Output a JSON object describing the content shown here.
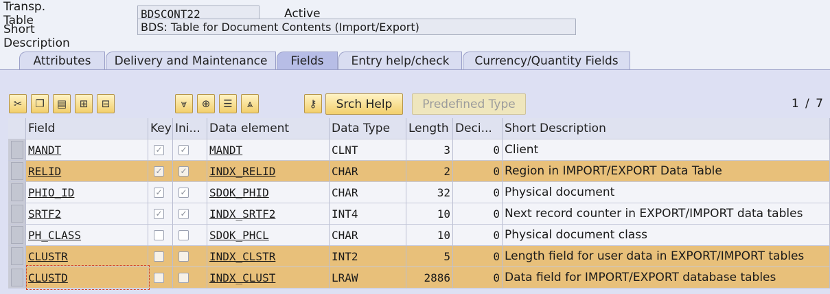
{
  "header": {
    "table_label": "Transp. Table",
    "table_value": "BDSCONT22",
    "status": "Active",
    "desc_label": "Short Description",
    "desc_value": "BDS: Table for Document Contents (Import/Export)"
  },
  "tabs": [
    {
      "label": "Attributes"
    },
    {
      "label": "Delivery and Maintenance"
    },
    {
      "label": "Fields"
    },
    {
      "label": "Entry help/check"
    },
    {
      "label": "Currency/Quantity Fields"
    }
  ],
  "active_tab": "Fields",
  "toolbar": {
    "srch_help": "Srch Help",
    "predefined_type": "Predefined Type",
    "pager": "1 / 7",
    "icons": [
      "cut-icon",
      "copy-icon",
      "paste-icon",
      "insert-row-icon",
      "delete-row-icon",
      "sort-icon",
      "insert-icon",
      "sort-desc-icon",
      "sort-asc-icon",
      "key-icon"
    ]
  },
  "columns": [
    "Field",
    "Key",
    "Ini...",
    "Data element",
    "Data Type",
    "Length",
    "Deci...",
    "Short Description"
  ],
  "rows": [
    {
      "field": "MANDT",
      "key": true,
      "ini": true,
      "element": "MANDT",
      "type": "CLNT",
      "length": "3",
      "deci": "0",
      "desc": "Client",
      "highlight": false
    },
    {
      "field": "RELID",
      "key": true,
      "ini": true,
      "element": "INDX_RELID",
      "type": "CHAR",
      "length": "2",
      "deci": "0",
      "desc": "Region in IMPORT/EXPORT Data Table",
      "highlight": true
    },
    {
      "field": "PHIO_ID",
      "key": true,
      "ini": true,
      "element": "SDOK_PHID",
      "type": "CHAR",
      "length": "32",
      "deci": "0",
      "desc": "Physical document",
      "highlight": false
    },
    {
      "field": "SRTF2",
      "key": true,
      "ini": true,
      "element": "INDX_SRTF2",
      "type": "INT4",
      "length": "10",
      "deci": "0",
      "desc": "Next record counter in EXPORT/IMPORT data tables",
      "highlight": false
    },
    {
      "field": "PH_CLASS",
      "key": false,
      "ini": false,
      "element": "SDOK_PHCL",
      "type": "CHAR",
      "length": "10",
      "deci": "0",
      "desc": "Physical document class",
      "highlight": false
    },
    {
      "field": "CLUSTR",
      "key": false,
      "ini": false,
      "element": "INDX_CLSTR",
      "type": "INT2",
      "length": "5",
      "deci": "0",
      "desc": "Length field for user data in EXPORT/IMPORT tables",
      "highlight": true
    },
    {
      "field": "CLUSTD",
      "key": false,
      "ini": false,
      "element": "INDX_CLUST",
      "type": "LRAW",
      "length": "2886",
      "deci": "0",
      "desc": "Data field for IMPORT/EXPORT database tables",
      "highlight": true
    }
  ],
  "colors": {
    "highlight_row": "#e8c07a",
    "panel": "#dde0f3",
    "button": "#f2cf6c"
  }
}
